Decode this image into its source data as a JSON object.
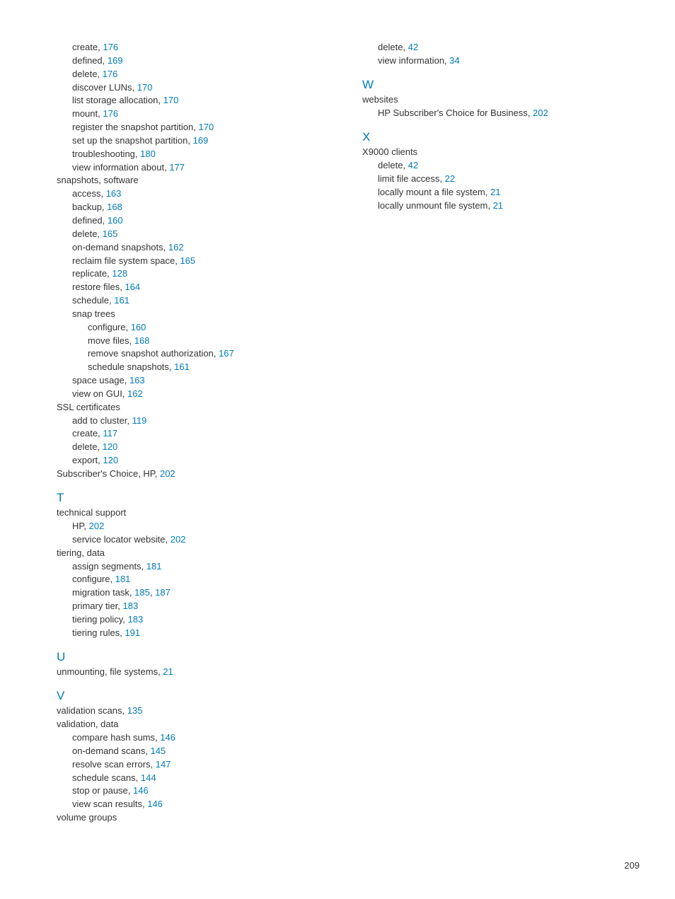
{
  "page_number": "209",
  "left_column": [
    {
      "type": "entry",
      "indent": 1,
      "label": "create,",
      "pages": [
        "176"
      ]
    },
    {
      "type": "entry",
      "indent": 1,
      "label": "defined,",
      "pages": [
        "169"
      ]
    },
    {
      "type": "entry",
      "indent": 1,
      "label": "delete,",
      "pages": [
        "176"
      ]
    },
    {
      "type": "entry",
      "indent": 1,
      "label": "discover LUNs,",
      "pages": [
        "170"
      ]
    },
    {
      "type": "entry",
      "indent": 1,
      "label": "list storage allocation,",
      "pages": [
        "170"
      ]
    },
    {
      "type": "entry",
      "indent": 1,
      "label": "mount,",
      "pages": [
        "176"
      ]
    },
    {
      "type": "entry",
      "indent": 1,
      "label": "register the snapshot partition,",
      "pages": [
        "170"
      ]
    },
    {
      "type": "entry",
      "indent": 1,
      "label": "set up the snapshot partition,",
      "pages": [
        "169"
      ]
    },
    {
      "type": "entry",
      "indent": 1,
      "label": "troubleshooting,",
      "pages": [
        "180"
      ]
    },
    {
      "type": "entry",
      "indent": 1,
      "label": "view information about,",
      "pages": [
        "177"
      ]
    },
    {
      "type": "entry",
      "indent": 0,
      "label": "snapshots, software",
      "pages": []
    },
    {
      "type": "entry",
      "indent": 1,
      "label": "access,",
      "pages": [
        "163"
      ]
    },
    {
      "type": "entry",
      "indent": 1,
      "label": "backup,",
      "pages": [
        "168"
      ]
    },
    {
      "type": "entry",
      "indent": 1,
      "label": "defined,",
      "pages": [
        "160"
      ]
    },
    {
      "type": "entry",
      "indent": 1,
      "label": "delete,",
      "pages": [
        "165"
      ]
    },
    {
      "type": "entry",
      "indent": 1,
      "label": "on-demand snapshots,",
      "pages": [
        "162"
      ]
    },
    {
      "type": "entry",
      "indent": 1,
      "label": "reclaim file system space,",
      "pages": [
        "165"
      ]
    },
    {
      "type": "entry",
      "indent": 1,
      "label": "replicate,",
      "pages": [
        "128"
      ]
    },
    {
      "type": "entry",
      "indent": 1,
      "label": "restore files,",
      "pages": [
        "164"
      ]
    },
    {
      "type": "entry",
      "indent": 1,
      "label": "schedule,",
      "pages": [
        "161"
      ]
    },
    {
      "type": "entry",
      "indent": 1,
      "label": "snap trees",
      "pages": []
    },
    {
      "type": "entry",
      "indent": 2,
      "label": "configure,",
      "pages": [
        "160"
      ]
    },
    {
      "type": "entry",
      "indent": 2,
      "label": "move files,",
      "pages": [
        "168"
      ]
    },
    {
      "type": "entry",
      "indent": 2,
      "label": "remove snapshot authorization,",
      "pages": [
        "167"
      ]
    },
    {
      "type": "entry",
      "indent": 2,
      "label": "schedule snapshots,",
      "pages": [
        "161"
      ]
    },
    {
      "type": "entry",
      "indent": 1,
      "label": "space usage,",
      "pages": [
        "163"
      ]
    },
    {
      "type": "entry",
      "indent": 1,
      "label": "view on GUI,",
      "pages": [
        "162"
      ]
    },
    {
      "type": "entry",
      "indent": 0,
      "label": "SSL certificates",
      "pages": []
    },
    {
      "type": "entry",
      "indent": 1,
      "label": "add to cluster,",
      "pages": [
        "119"
      ]
    },
    {
      "type": "entry",
      "indent": 1,
      "label": "create,",
      "pages": [
        "117"
      ]
    },
    {
      "type": "entry",
      "indent": 1,
      "label": "delete,",
      "pages": [
        "120"
      ]
    },
    {
      "type": "entry",
      "indent": 1,
      "label": "export,",
      "pages": [
        "120"
      ]
    },
    {
      "type": "entry",
      "indent": 0,
      "label": "Subscriber's Choice, HP,",
      "pages": [
        "202"
      ]
    },
    {
      "type": "letter",
      "label": "T"
    },
    {
      "type": "entry",
      "indent": 0,
      "label": "technical support",
      "pages": []
    },
    {
      "type": "entry",
      "indent": 1,
      "label": "HP,",
      "pages": [
        "202"
      ]
    },
    {
      "type": "entry",
      "indent": 1,
      "label": "service locator website,",
      "pages": [
        "202"
      ]
    },
    {
      "type": "entry",
      "indent": 0,
      "label": "tiering, data",
      "pages": []
    },
    {
      "type": "entry",
      "indent": 1,
      "label": "assign segments,",
      "pages": [
        "181"
      ]
    },
    {
      "type": "entry",
      "indent": 1,
      "label": "configure,",
      "pages": [
        "181"
      ]
    },
    {
      "type": "entry",
      "indent": 1,
      "label": "migration task,",
      "pages": [
        "185",
        "187"
      ]
    },
    {
      "type": "entry",
      "indent": 1,
      "label": "primary tier,",
      "pages": [
        "183"
      ]
    },
    {
      "type": "entry",
      "indent": 1,
      "label": "tiering policy,",
      "pages": [
        "183"
      ]
    },
    {
      "type": "entry",
      "indent": 1,
      "label": "tiering rules,",
      "pages": [
        "191"
      ]
    },
    {
      "type": "letter",
      "label": "U"
    },
    {
      "type": "entry",
      "indent": 0,
      "label": "unmounting, file systems,",
      "pages": [
        "21"
      ]
    },
    {
      "type": "letter",
      "label": "V"
    },
    {
      "type": "entry",
      "indent": 0,
      "label": "validation scans,",
      "pages": [
        "135"
      ]
    },
    {
      "type": "entry",
      "indent": 0,
      "label": "validation, data",
      "pages": []
    },
    {
      "type": "entry",
      "indent": 1,
      "label": "compare hash sums,",
      "pages": [
        "146"
      ]
    },
    {
      "type": "entry",
      "indent": 1,
      "label": "on-demand scans,",
      "pages": [
        "145"
      ]
    },
    {
      "type": "entry",
      "indent": 1,
      "label": "resolve scan errors,",
      "pages": [
        "147"
      ]
    },
    {
      "type": "entry",
      "indent": 1,
      "label": "schedule scans,",
      "pages": [
        "144"
      ]
    },
    {
      "type": "entry",
      "indent": 1,
      "label": "stop or pause,",
      "pages": [
        "146"
      ]
    },
    {
      "type": "entry",
      "indent": 1,
      "label": "view scan results,",
      "pages": [
        "146"
      ]
    },
    {
      "type": "entry",
      "indent": 0,
      "label": "volume groups",
      "pages": []
    }
  ],
  "right_column": [
    {
      "type": "entry",
      "indent": 1,
      "label": "delete,",
      "pages": [
        "42"
      ]
    },
    {
      "type": "entry",
      "indent": 1,
      "label": "view information,",
      "pages": [
        "34"
      ]
    },
    {
      "type": "letter",
      "label": "W"
    },
    {
      "type": "entry",
      "indent": 0,
      "label": "websites",
      "pages": []
    },
    {
      "type": "entry",
      "indent": 1,
      "label": "HP Subscriber's Choice for Business,",
      "pages": [
        "202"
      ]
    },
    {
      "type": "letter",
      "label": "X"
    },
    {
      "type": "entry",
      "indent": 0,
      "label": "X9000 clients",
      "pages": []
    },
    {
      "type": "entry",
      "indent": 1,
      "label": "delete,",
      "pages": [
        "42"
      ]
    },
    {
      "type": "entry",
      "indent": 1,
      "label": "limit file access,",
      "pages": [
        "22"
      ]
    },
    {
      "type": "entry",
      "indent": 1,
      "label": "locally mount a file system,",
      "pages": [
        "21"
      ]
    },
    {
      "type": "entry",
      "indent": 1,
      "label": "locally unmount file system,",
      "pages": [
        "21"
      ]
    }
  ]
}
